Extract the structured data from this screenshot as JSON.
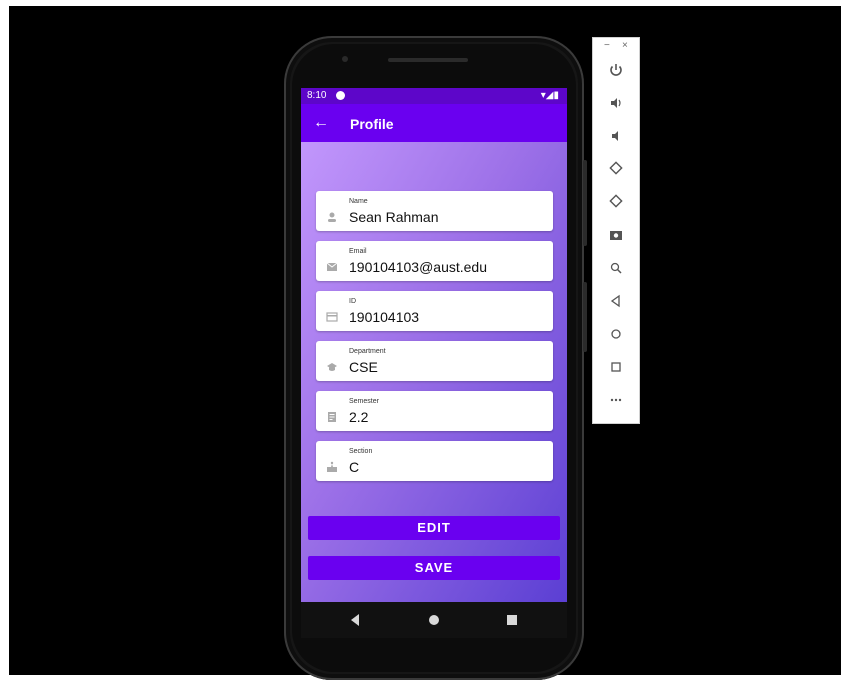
{
  "status": {
    "time": "8:10",
    "icons": "▾◢▮"
  },
  "appbar": {
    "title": "Profile",
    "back_icon": "arrow-left-icon"
  },
  "fields": [
    {
      "label": "Name",
      "value": "Sean Rahman",
      "icon": "person-icon"
    },
    {
      "label": "Email",
      "value": "190104103@aust.edu",
      "icon": "mail-icon"
    },
    {
      "label": "ID",
      "value": "190104103",
      "icon": "card-icon"
    },
    {
      "label": "Department",
      "value": "CSE",
      "icon": "school-icon"
    },
    {
      "label": "Semester",
      "value": "2.2",
      "icon": "notes-icon"
    },
    {
      "label": "Section",
      "value": "C",
      "icon": "sign-icon"
    }
  ],
  "buttons": {
    "edit": "EDIT",
    "save": "SAVE"
  },
  "emulator": {
    "minimize": "−",
    "close": "×",
    "tools": [
      "power-icon",
      "volume-up-icon",
      "volume-down-icon",
      "rotate-left-icon",
      "rotate-right-icon",
      "camera-icon",
      "zoom-icon",
      "back-icon",
      "home-icon",
      "overview-icon",
      "more-icon"
    ]
  },
  "colors": {
    "appbar": "#6a00f0",
    "statusbar": "#5d06c9",
    "button": "#6a00f0"
  }
}
